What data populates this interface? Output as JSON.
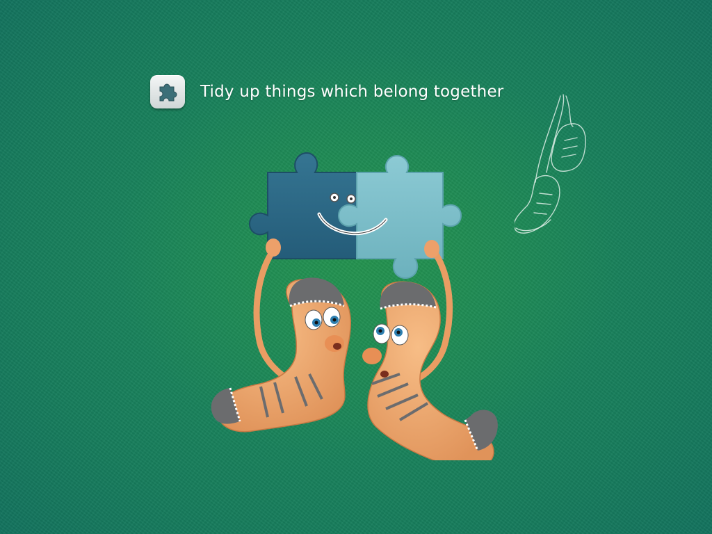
{
  "instruction": {
    "text": "Tidy up things which belong together",
    "icon": "puzzle-piece-icon"
  },
  "illustration": {
    "subject": "socks-holding-puzzle-pieces",
    "puzzle_left_color": "#2c6a8c",
    "puzzle_right_color": "#7fc0cc",
    "sock_color": "#f1a96c",
    "stripe_color": "#6b6c6e"
  },
  "decoration": {
    "icon": "sneakers-sketch-icon"
  },
  "colors": {
    "background": "#1a8760",
    "text": "#ffffff"
  }
}
